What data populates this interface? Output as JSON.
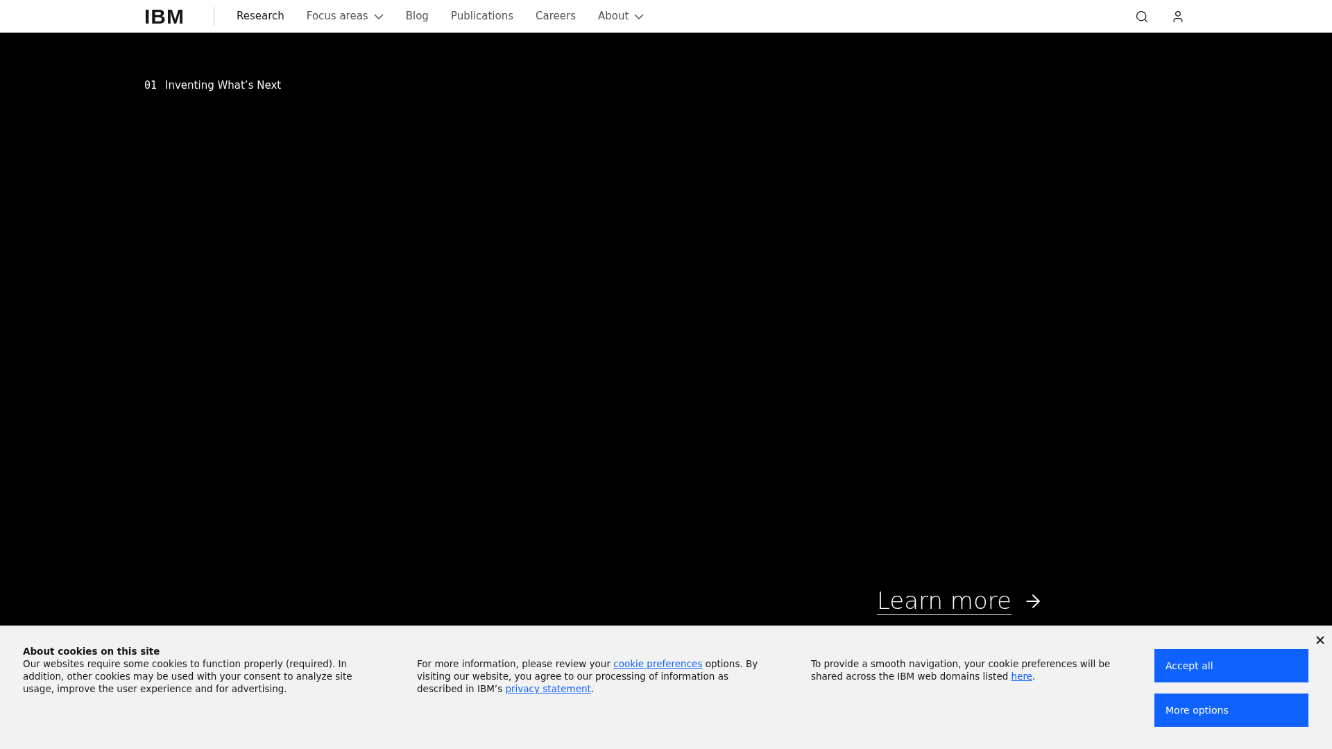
{
  "nav": {
    "logo": "IBM",
    "items": [
      {
        "label": "Research",
        "selected": true,
        "dropdown": false
      },
      {
        "label": "Focus areas",
        "selected": false,
        "dropdown": true
      },
      {
        "label": "Blog",
        "selected": false,
        "dropdown": false
      },
      {
        "label": "Publications",
        "selected": false,
        "dropdown": false
      },
      {
        "label": "Careers",
        "selected": false,
        "dropdown": false
      },
      {
        "label": "About",
        "selected": false,
        "dropdown": true
      }
    ]
  },
  "hero": {
    "index": "01",
    "label": "Inventing What’s Next",
    "link": "Learn more"
  },
  "cookie_banner": {
    "title": "About cookies on this site",
    "paragraph_1": "Our websites require some cookies to function properly (required). In addition, other cookies may be used with your consent to analyze site usage, improve the user experience and for advertising.",
    "paragraph_2": {
      "before": "For more information, please review your",
      "link_1": "cookie preferences",
      "middle": "options. By visiting our website, you agree to our processing of information as described in IBM’s",
      "link_2": "privacy statement",
      "after": "."
    },
    "paragraph_3": {
      "before": "To provide a smooth navigation, your cookie preferences will be shared across the IBM web domains listed",
      "link": "here",
      "after": "."
    },
    "buttons": [
      "Accept all",
      "More options"
    ]
  }
}
